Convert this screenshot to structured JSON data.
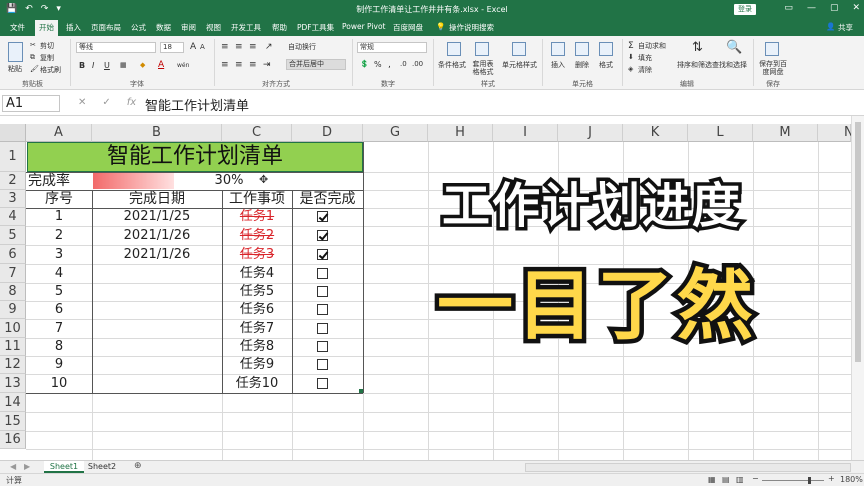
{
  "titlebar": {
    "title": "制作工作清单让工作井井有条.xlsx - Excel",
    "login": "登录",
    "qat": [
      "💾",
      "↶",
      "↷",
      "▾"
    ],
    "ctrls": [
      "▭",
      "—",
      "▢",
      "✕"
    ]
  },
  "tabs": [
    "文件",
    "开始",
    "插入",
    "页面布局",
    "公式",
    "数据",
    "审阅",
    "视图",
    "开发工具",
    "帮助",
    "PDF工具集",
    "Power Pivot",
    "百度网盘",
    "操作说明搜索",
    "共享"
  ],
  "ribbon": {
    "clipboard": {
      "cut": "剪切",
      "copy": "复制",
      "painter": "格式刷",
      "paste": "粘贴",
      "label": "剪贴板"
    },
    "font": {
      "name": "等线",
      "size": "18",
      "label": "字体",
      "bold": "B",
      "italic": "I",
      "underline": "U",
      "grow": "A",
      "shrink": "A",
      "color_a": "A",
      "wen": "wén"
    },
    "align": {
      "wrap": "自动换行",
      "merge": "合并后居中",
      "label": "对齐方式"
    },
    "number": {
      "format": "常规",
      "label": "数字",
      "percent": "%",
      "comma": ",",
      "currency": "%"
    },
    "styles": {
      "cond": "条件格式",
      "table": "套用表格格式",
      "cell": "单元格样式",
      "label": "样式"
    },
    "cells": {
      "insert": "插入",
      "delete": "删除",
      "format": "格式",
      "label": "单元格"
    },
    "editing": {
      "autosum": "自动求和",
      "fill": "填充",
      "clear": "清除",
      "sort": "排序和筛选",
      "find": "查找和选择",
      "label": "编辑"
    },
    "save": {
      "save": "保存到百度网盘",
      "label": "保存"
    }
  },
  "formula": {
    "namebox": "A1",
    "cancel": "✕",
    "enter": "✓",
    "fx": "fx",
    "content": "智能工作计划清单"
  },
  "columns": [
    "A",
    "B",
    "C",
    "D",
    "G",
    "H",
    "I",
    "J",
    "K",
    "L",
    "M",
    "N"
  ],
  "rows": [
    "1",
    "2",
    "3",
    "4",
    "5",
    "6",
    "7",
    "8",
    "9",
    "10",
    "11",
    "12",
    "13",
    "14",
    "15",
    "16"
  ],
  "sheet": {
    "title": "智能工作计划清单",
    "rate_label": "完成率",
    "rate_value": "30%",
    "rate_fraction": 0.3,
    "headers": [
      "序号",
      "完成日期",
      "工作事项",
      "是否完成"
    ],
    "tasks": [
      {
        "no": "1",
        "date": "2021/1/25",
        "item": "任务1",
        "done": true
      },
      {
        "no": "2",
        "date": "2021/1/26",
        "item": "任务2",
        "done": true
      },
      {
        "no": "3",
        "date": "2021/1/26",
        "item": "任务3",
        "done": true
      },
      {
        "no": "4",
        "date": "",
        "item": "任务4",
        "done": false
      },
      {
        "no": "5",
        "date": "",
        "item": "任务5",
        "done": false
      },
      {
        "no": "6",
        "date": "",
        "item": "任务6",
        "done": false
      },
      {
        "no": "7",
        "date": "",
        "item": "任务7",
        "done": false
      },
      {
        "no": "8",
        "date": "",
        "item": "任务8",
        "done": false
      },
      {
        "no": "9",
        "date": "",
        "item": "任务9",
        "done": false
      },
      {
        "no": "10",
        "date": "",
        "item": "任务10",
        "done": false
      }
    ]
  },
  "overlay": {
    "line1": "工作计划进度",
    "line2": "一目了然"
  },
  "sheets": [
    "Sheet1",
    "Sheet2"
  ],
  "status": {
    "ready": "计算",
    "zoom": "180%"
  },
  "colors": {
    "excel_green": "#217346",
    "title_fill": "#92d050",
    "bar_red": "#ff0000",
    "overlay_yellow": "#ffd84a"
  }
}
